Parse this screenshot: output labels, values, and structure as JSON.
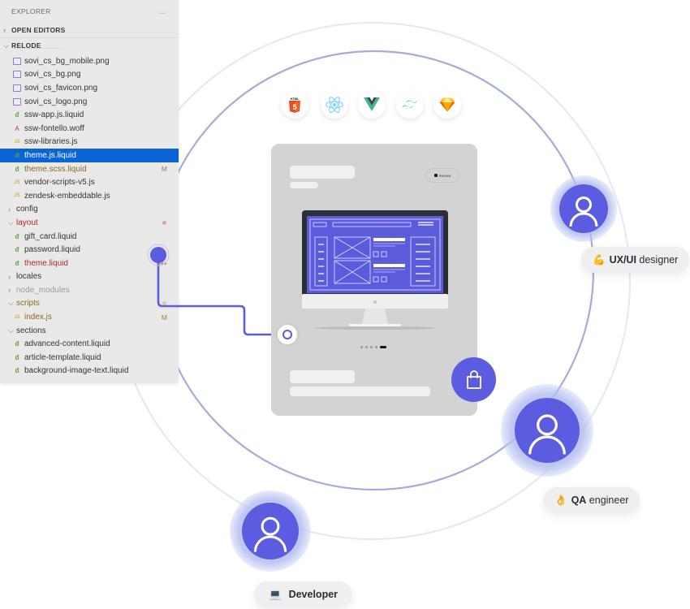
{
  "explorer": {
    "title": "EXPLORER",
    "more_icon": "…",
    "sections": {
      "open_editors": "OPEN EDITORS",
      "project": "RELODE"
    },
    "items": [
      {
        "label": "sovi_cs_bg_mobile.png",
        "icon": "image-icon",
        "indent": 1
      },
      {
        "label": "sovi_cs_bg.png",
        "icon": "image-icon",
        "indent": 1
      },
      {
        "label": "sovi_cs_favicon.png",
        "icon": "image-icon",
        "indent": 1
      },
      {
        "label": "sovi_cs_logo.png",
        "icon": "image-icon",
        "indent": 1
      },
      {
        "label": "ssw-app.js.liquid",
        "icon": "liquid-icon",
        "indent": 1
      },
      {
        "label": "ssw-fontello.woff",
        "icon": "font-icon",
        "indent": 1
      },
      {
        "label": "ssw-libraries.js",
        "icon": "js-icon",
        "indent": 1
      },
      {
        "label": "theme.js.liquid",
        "icon": "liquid-icon",
        "indent": 1,
        "selected": true
      },
      {
        "label": "theme.scss.liquid",
        "icon": "liquid-icon",
        "indent": 1,
        "status": "M",
        "color": "#8a6a1e"
      },
      {
        "label": "vendor-scripts-v5.js",
        "icon": "js-icon",
        "indent": 1
      },
      {
        "label": "zendesk-embeddable.js",
        "icon": "js-icon",
        "indent": 1
      },
      {
        "label": "config",
        "folder": "collapsed",
        "indent": 0
      },
      {
        "label": "layout",
        "folder": "expanded",
        "indent": 0,
        "color": "#b3262b",
        "dot": "#e8a3a3"
      },
      {
        "label": "gift_card.liquid",
        "icon": "liquid-icon",
        "indent": 1
      },
      {
        "label": "password.liquid",
        "icon": "liquid-icon",
        "indent": 1
      },
      {
        "label": "theme.liquid",
        "icon": "liquid-icon",
        "indent": 1,
        "color": "#b3262b",
        "status": "9+",
        "status_color": "#c0392b"
      },
      {
        "label": "locales",
        "folder": "collapsed",
        "indent": 0
      },
      {
        "label": "node_modules",
        "folder": "collapsed",
        "indent": 0,
        "color": "#9a9a9a"
      },
      {
        "label": "scripts",
        "folder": "expanded",
        "indent": 0,
        "color": "#8a6a1e",
        "dot": "#e0c9a2"
      },
      {
        "label": "index.js",
        "icon": "js-icon",
        "indent": 1,
        "color": "#8a6a1e",
        "status": "M"
      },
      {
        "label": "sections",
        "folder": "expanded",
        "indent": 0
      },
      {
        "label": "advanced-content.liquid",
        "icon": "liquid-icon",
        "indent": 1
      },
      {
        "label": "article-template.liquid",
        "icon": "liquid-icon",
        "indent": 1
      },
      {
        "label": "background-image-text.liquid",
        "icon": "liquid-icon",
        "indent": 1
      }
    ]
  },
  "tech_stack": [
    {
      "name": "HTML5",
      "icon": "html5-icon"
    },
    {
      "name": "React",
      "icon": "react-icon"
    },
    {
      "name": "Vue",
      "icon": "vue-icon"
    },
    {
      "name": "Tailwind CSS",
      "icon": "tailwind-icon"
    },
    {
      "name": "Sketch",
      "icon": "sketch-icon"
    }
  ],
  "preview_card": {
    "review_label": "Review",
    "carousel": {
      "count": 5,
      "active_index": 4
    },
    "cart_icon": "shopping-bag-icon"
  },
  "roles": [
    {
      "emoji": "💪",
      "strong": "UX/UI",
      "rest": " designer"
    },
    {
      "emoji": "👌",
      "strong": "QA",
      "rest": " engineer"
    },
    {
      "emoji": "💻",
      "strong": "Developer",
      "rest": ""
    }
  ],
  "colors": {
    "accent": "#5c5ce0",
    "selection": "#0a64d6",
    "card_bg": "#d3d3d3",
    "orbit": "#9aa4d8"
  }
}
